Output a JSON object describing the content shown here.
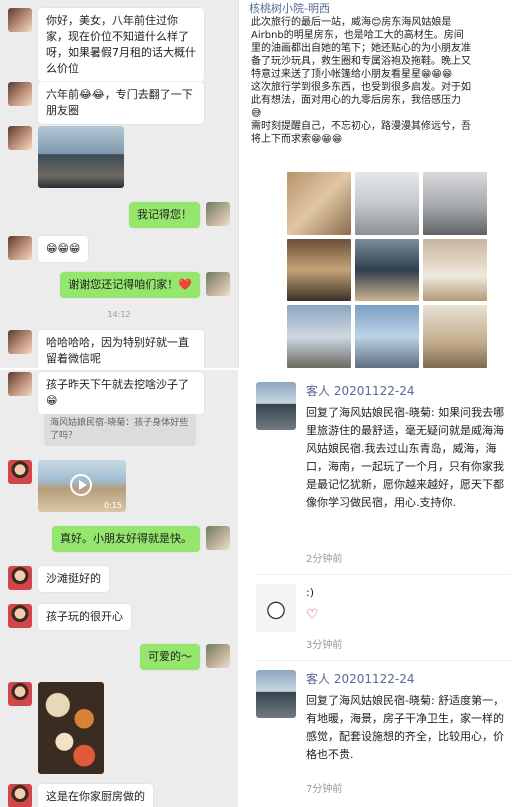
{
  "topLeft": {
    "messages": [
      {
        "text": "你好，美女，八年前住过你家，现在价位不知道什么样了呀，如果暑假7月租的话大概什么价位"
      },
      {
        "text": "六年前😂😂，专门去翻了一下朋友圈"
      },
      {
        "text": "我记得您！"
      },
      {
        "text": "😁😁😁"
      },
      {
        "text": "谢谢您还记得咱们家！❤️"
      },
      {
        "text": "哈哈哈哈，因为特别好就一直留着微信呢"
      }
    ],
    "timestamp": "14:12"
  },
  "topRight": {
    "title": "核桃树小院-明西",
    "body": "此次旅行的最后一站，威海😊房东海风姑娘是Airbnb的明星房东，也是哈工大的高材生。房间里的油画都出自她的笔下；她还贴心的为小朋友准备了玩沙玩具，救生圈和专属浴袍及拖鞋。晚上又特意过来送了顶小帐篷给小朋友看星星😁😁😁\n这次旅行学到很多东西，也受到很多启发。对于如此有想法，面对用心的九零后房东，我倍感压力😅\n需时刻提醒自己，不忘初心，路漫漫其修远兮，吾将上下而求索😁😁😁"
  },
  "bottomLeft": {
    "topMessage": "孩子昨天下午就去挖啥沙子了😁",
    "quote": "海风姑娘民宿-晓菊：孩子身体好些了吗？",
    "videoDuration": "0:15",
    "messages": [
      {
        "text": "真好。小朋友好得就是快。"
      },
      {
        "text": "沙滩挺好的"
      },
      {
        "text": "孩子玩的很开心"
      },
      {
        "text": "可爱的～"
      },
      {
        "text": "这是在你家厨房做的"
      }
    ]
  },
  "bottomRight": {
    "comments": [
      {
        "name": "客人 20201122-24",
        "text": "回复了海风姑娘民宿-晓菊: 如果问我去哪里旅游住的最舒适，毫无疑问就是威海海风姑娘民宿.我去过山东青岛，威海，海口，海南，一起玩了一个月，只有你家我是最记忆犹新，愿你越来越好，愿天下都像你学习做民宿，用心.支持你.",
        "time": "2分钟前"
      },
      {
        "name": "",
        "text": ":)",
        "heart": "♡",
        "time": "3分钟前"
      },
      {
        "name": "客人 20201122-24",
        "text": "回复了海风姑娘民宿-晓菊: 舒适度第一，有地暖，海景，房子干净卫生，家一样的感觉，配套设施想的齐全，比较用心，价格也不贵.",
        "time": "7分钟前"
      }
    ]
  }
}
